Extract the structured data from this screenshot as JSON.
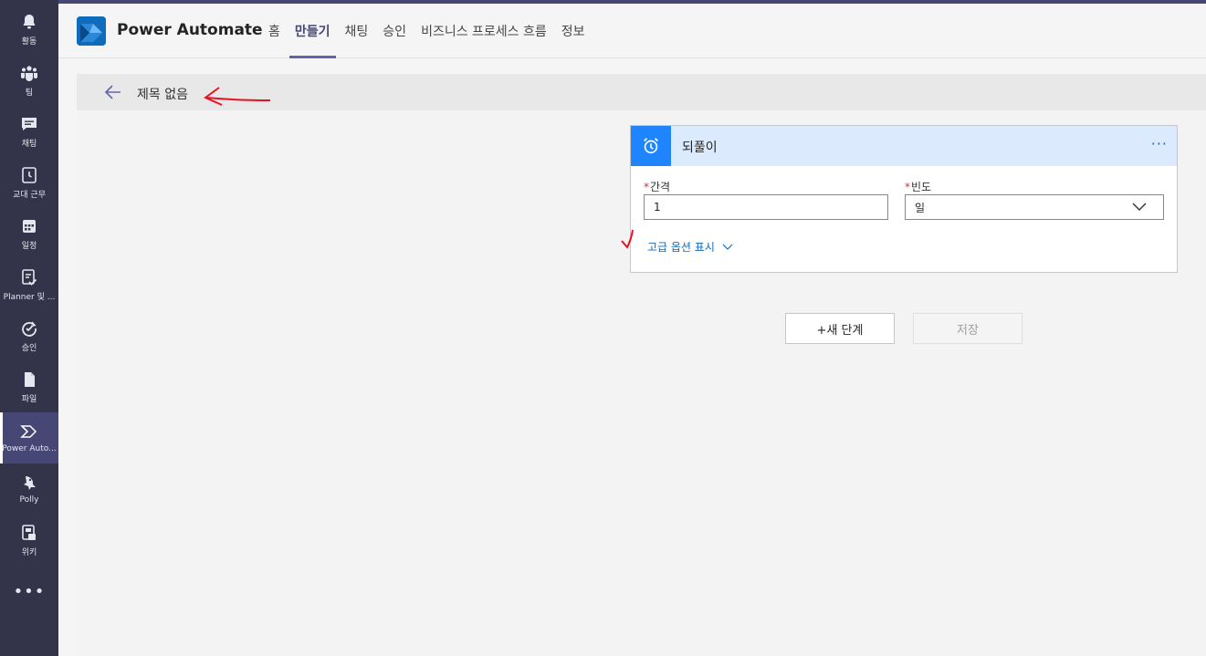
{
  "rail": {
    "items": [
      {
        "label": "활동",
        "icon": "bell-icon"
      },
      {
        "label": "팀",
        "icon": "teams-icon"
      },
      {
        "label": "채팅",
        "icon": "chat-icon"
      },
      {
        "label": "교대 근무",
        "icon": "clock-icon"
      },
      {
        "label": "일정",
        "icon": "calendar-icon"
      },
      {
        "label": "Planner 및 ...",
        "icon": "planner-icon"
      },
      {
        "label": "승인",
        "icon": "approvals-icon"
      },
      {
        "label": "파일",
        "icon": "file-icon"
      },
      {
        "label": "Power Auto...",
        "icon": "power-automate-icon",
        "active": true
      },
      {
        "label": "Polly",
        "icon": "polly-icon"
      },
      {
        "label": "위키",
        "icon": "wiki-icon"
      }
    ],
    "more_label": "•••"
  },
  "app": {
    "title": "Power Automate",
    "tabs": [
      {
        "label": "홈"
      },
      {
        "label": "만들기",
        "active": true
      },
      {
        "label": "채팅"
      },
      {
        "label": "승인"
      },
      {
        "label": "비즈니스 프로세스 흐름"
      },
      {
        "label": "정보"
      }
    ]
  },
  "flow": {
    "title": "제목 없음"
  },
  "trigger": {
    "title": "되풀이",
    "more": "···",
    "required_mark": "*",
    "interval_label": "간격",
    "interval_value": "1",
    "frequency_label": "빈도",
    "frequency_value": "일",
    "advanced_label": "고급 옵션 표시"
  },
  "actions": {
    "new_step": "+새 단계",
    "save": "저장"
  },
  "colors": {
    "rail_bg": "#33344a",
    "accent": "#6264a7",
    "card_header": "#dbeafc",
    "trigger_icon_bg": "#1f85ff",
    "link": "#0f6cbd",
    "annotation": "#e81123"
  }
}
